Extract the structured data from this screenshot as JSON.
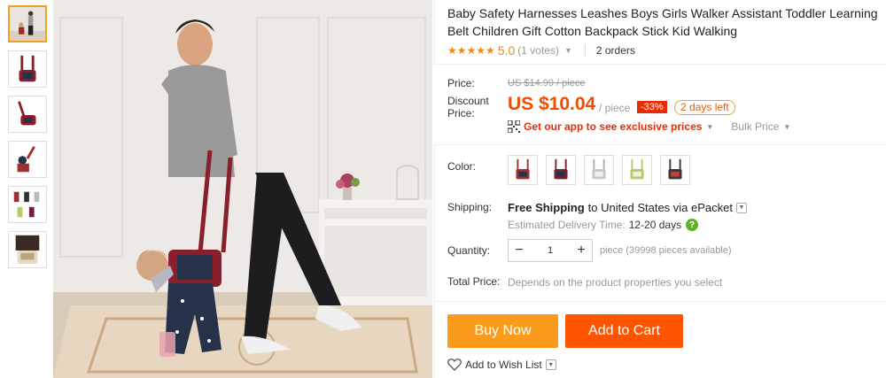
{
  "product": {
    "title": "Baby Safety Harnesses Leashes Boys Girls Walker Assistant Toddler Learning Belt Children Gift Cotton Backpack Stick Kid Walking"
  },
  "rating": {
    "stars": "★★★★★",
    "score": "5.0",
    "votes": "(1 votes)",
    "orders": "2 orders"
  },
  "price": {
    "label": "Price:",
    "original": "US $14.99 / piece",
    "discount_label": "Discount Price:",
    "current": "US $10.04",
    "unit": "/ piece",
    "off": "-33%",
    "days_left": "2 days left",
    "app_promo": "Get our app to see exclusive prices",
    "bulk": "Bulk Price"
  },
  "color": {
    "label": "Color:",
    "swatch_accents": [
      "#a03030",
      "#7a1f2b",
      "#b0b0b0",
      "#b8c86a",
      "#3a3a3a"
    ]
  },
  "shipping": {
    "label": "Shipping:",
    "free": "Free Shipping",
    "to": "to United States via ePacket",
    "est_label": "Estimated Delivery Time:",
    "est_value": "12-20 days"
  },
  "quantity": {
    "label": "Quantity:",
    "value": "1",
    "minus": "−",
    "plus": "+",
    "note": "piece (39998 pieces available)"
  },
  "total": {
    "label": "Total Price:",
    "note": "Depends on the product properties you select"
  },
  "actions": {
    "buy_now": "Buy Now",
    "add_to_cart": "Add to Cart",
    "wishlist": "Add to Wish List"
  },
  "colors": {
    "price": "#f24b00",
    "badge": "#e62e04",
    "buy": "#fb9b1d",
    "cart": "#ff5500",
    "star": "#f58a12"
  }
}
